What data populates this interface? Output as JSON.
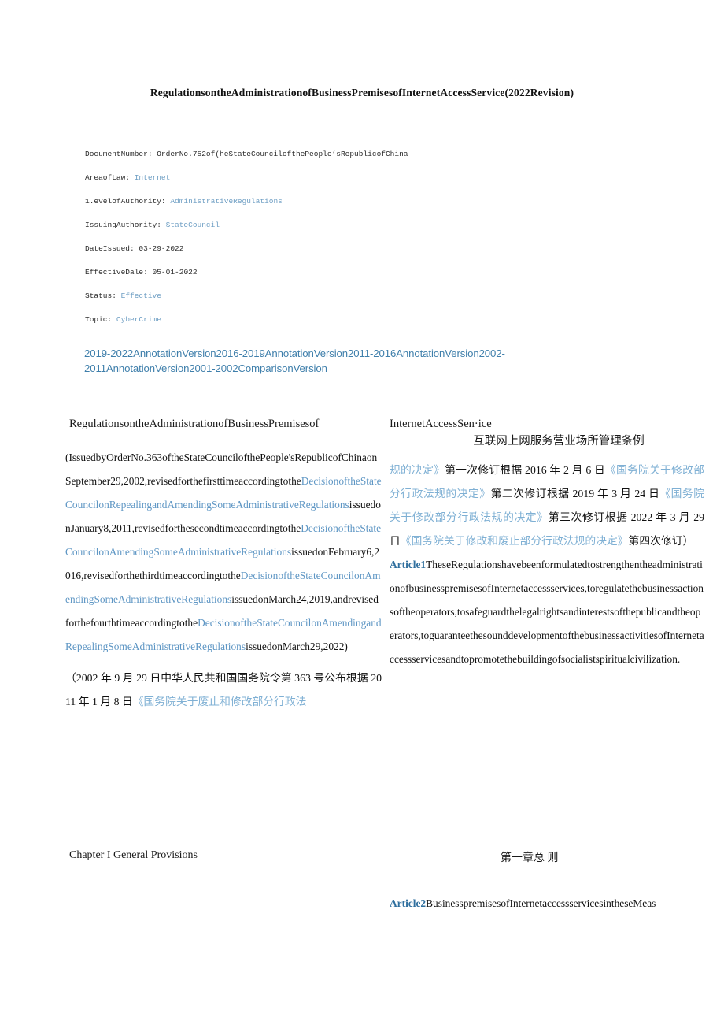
{
  "document": {
    "title": "RegulationsontheAdministrationofBusinessPremisesofInternetAccessService(2022Revision)"
  },
  "metadata": {
    "rows": [
      {
        "key": "DocumentNumber:",
        "value": "OrderNo.752of(heStateCouncilofthePeople’sRepublicofChina",
        "is_link": false
      },
      {
        "key": "AreaofLaw:",
        "value": "Internet",
        "is_link": true
      },
      {
        "key": "1.evelofAuthority:",
        "value": "AdministrativeRegulations",
        "is_link": true
      },
      {
        "key": "IssuingAuthority:",
        "value": "StateCouncil",
        "is_link": true
      },
      {
        "key": "DateIssued:",
        "value": "03-29-2022",
        "is_link": false
      },
      {
        "key": "EffectiveDale:",
        "value": "05-01-2022",
        "is_link": false
      },
      {
        "key": "Status:",
        "value": "Effective",
        "is_link": true
      },
      {
        "key": "Topic:",
        "value": "CyberCrime",
        "is_link": true
      }
    ]
  },
  "version_links": {
    "items": [
      "2019-2022AnnotationVersion",
      "2016-2019AnnotationVersion",
      "2011-2016AnnotationVersion",
      "2002-2011AnnotationVersion",
      "2001-2002ComparisonVersion"
    ]
  },
  "heading": {
    "english_line1": "RegulationsontheAdministrationofBusinessPremisesof",
    "english_line2": "InternetAccessSen·ice",
    "chinese": "互联网上网服务营业场所管理条例"
  },
  "left_column": {
    "preamble_en": [
      {
        "text": "(IssuedbyOrderNo.363oftheStateCouncilofthePeople'sRepublicofChinaonSeptember29,2002,revisedforthefirsttimeaccordingtothe",
        "link": false
      },
      {
        "text": "DecisionoftheStateCouncilonRepealingandAmendingSomeAdministrativeRegulations",
        "link": true
      },
      {
        "text": "issuedonJanuary8,2011,revisedforthesecondtimeaccordingtothe",
        "link": false
      },
      {
        "text": "DecisionoftheStateCouncilonAmendingSomeAdministrativeRegulations",
        "link": true
      },
      {
        "text": "issuedonFebruary6,2016,revisedforthethirdtimeaccordingtothe",
        "link": false
      },
      {
        "text": "DecisionoftheStateCouncilonAmendingSomeAdministrativeRegulations",
        "link": true
      },
      {
        "text": "issuedonMarch24,2019,andrevisedforthefourthtimeaccordingtothe",
        "link": false
      },
      {
        "text": "DecisionoftheStateCouncilonAmendingandRepealingSomeAdministrativeRegulations",
        "link": true
      },
      {
        "text": "issuedonMarch29,2022)",
        "link": false
      }
    ],
    "preamble_zh": [
      {
        "text": "（2002 年 9 月 29 日中华人民共和国国务院令第 363 号公布根据 2011 年 1 月 8 日",
        "link": false
      },
      {
        "text": "《国务院关于废止和修改部分行政法",
        "link": true
      }
    ],
    "chapter_heading": "Chapter I General Provisions"
  },
  "right_column": {
    "preamble_zh_cont": [
      {
        "text": "规的决定》",
        "link": true
      },
      {
        "text": "第一次修订根据 2016 年 2 月 6 日",
        "link": false
      },
      {
        "text": "《国务院关于修改部分行政法规的决定》",
        "link": true
      },
      {
        "text": "第二次修订根据 2019 年 3 月 24 日",
        "link": false
      },
      {
        "text": "《国务院关于修改部分行政法规的决定》",
        "link": true
      },
      {
        "text": "第三次修订根据 2022 年 3 月 29 日",
        "link": false
      },
      {
        "text": "《国务院关于修改和废止部分行政法规的决定》",
        "link": true
      },
      {
        "text": "第四次修订）",
        "link": false
      }
    ],
    "article1": {
      "number": "Article1",
      "text": "TheseRegulationshavebeenformulatedtostrengthentheadministrationofbusinesspremisesofInternetaccessservices,toregulatethebusinessactionsoftheoperators,tosafeguardthelegalrightsandinterestsofthepublicandtheoperators,toguaranteethesounddevelopmentofthebusinessactivitiesofInternetaccessservicesandtopromotethebuildingofsocialistspiritualcivilization."
    },
    "chapter_heading_zh": "第一章总 则",
    "article2": {
      "number": "Article2",
      "text": "BusinesspremisesofInternetaccessservicesintheseMeas"
    }
  }
}
